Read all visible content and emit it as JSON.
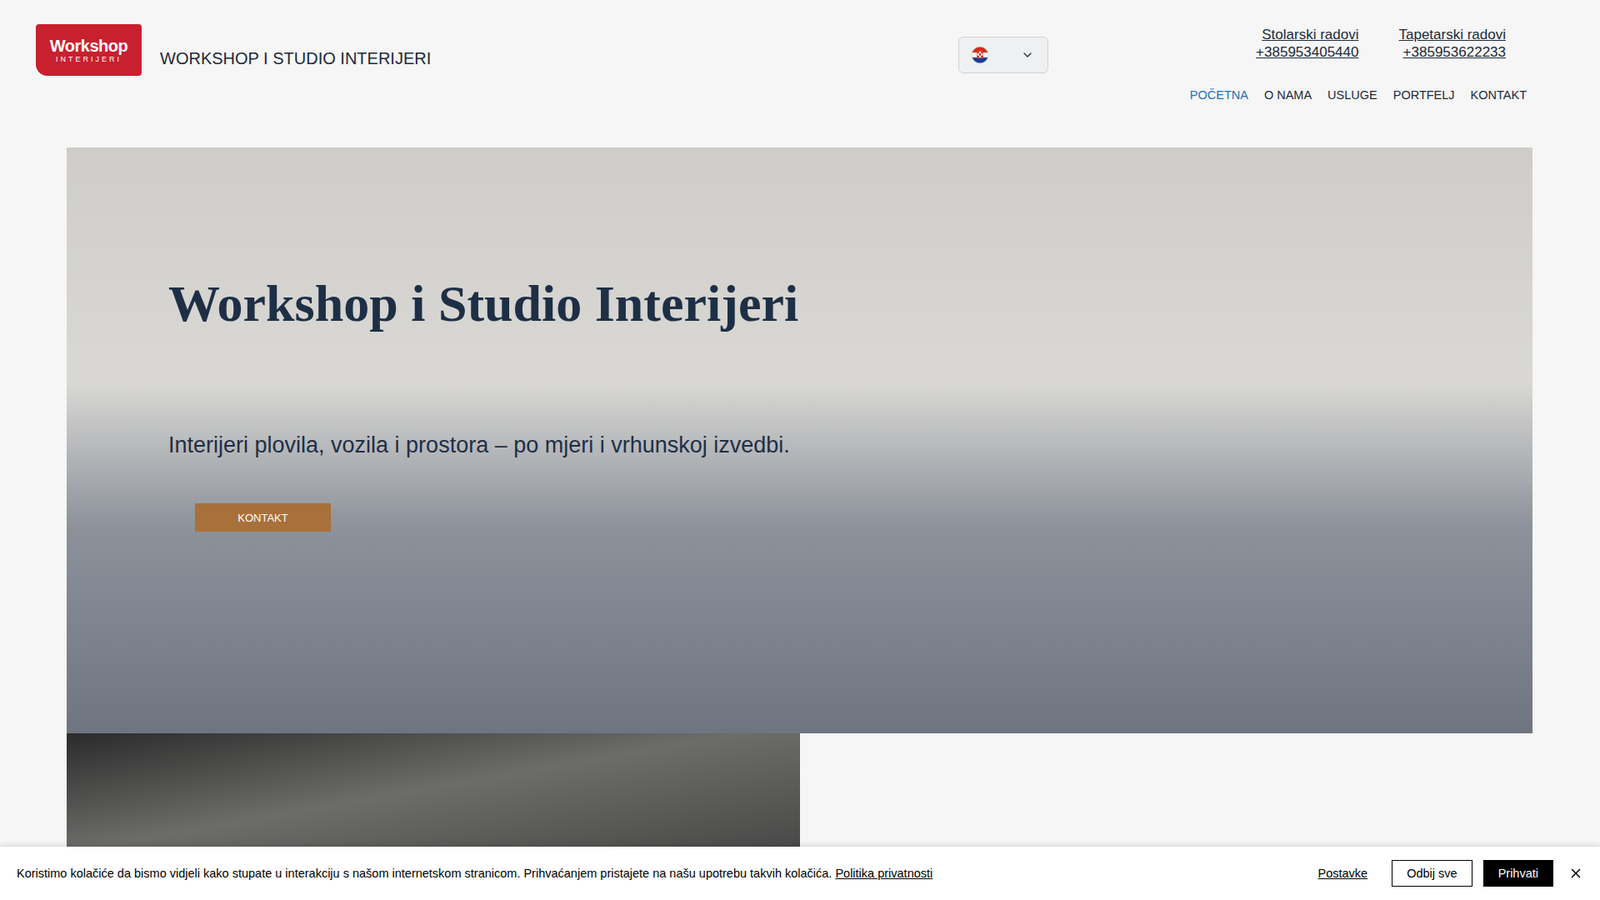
{
  "header": {
    "logo": {
      "line1": "Workshop",
      "line2": "INTERIJERI"
    },
    "site_title": "WORKSHOP I STUDIO INTERIJERI",
    "language_selector": {
      "expanded": false
    },
    "contacts": [
      {
        "label": "Stolarski radovi",
        "phone": "+385953405440"
      },
      {
        "label": "Tapetarski radovi",
        "phone": "+385953622233"
      }
    ]
  },
  "nav": [
    {
      "label": "POČETNA",
      "selected": true
    },
    {
      "label": "O NAMA",
      "selected": false
    },
    {
      "label": "USLUGE",
      "selected": false
    },
    {
      "label": "PORTFELJ",
      "selected": false
    },
    {
      "label": "KONTAKT",
      "selected": false
    }
  ],
  "hero": {
    "title": "Workshop i Studio Interijeri",
    "subtitle": "Interijeri plovila, vozila i prostora – po mjeri i vrhunskoj izvedbi.",
    "button": "KONTAKT"
  },
  "cookie_bar": {
    "text": "Koristimo kolačiće da bismo vidjeli kako stupate u interakciju s našom internetskom stranicom. Prihvaćanjem pristajete na našu upotrebu takvih kolačića.",
    "link": "Politika privatnosti",
    "buttons": [
      "Postavke",
      "Odbij sve",
      "Prihvati"
    ]
  }
}
